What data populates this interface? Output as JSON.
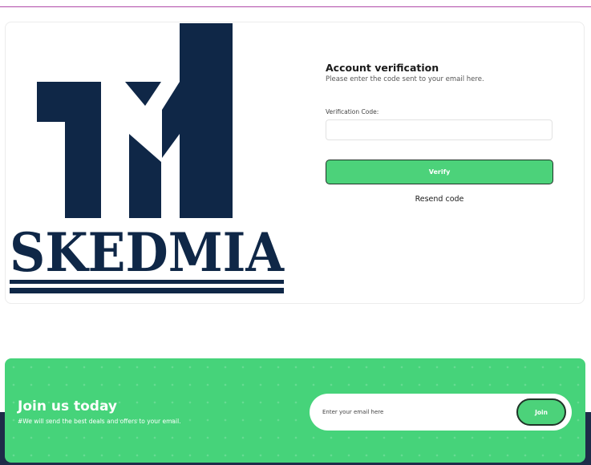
{
  "brand": {
    "name": "SKEDMIA",
    "logo_color": "#0f2747"
  },
  "verification": {
    "title": "Account verification",
    "subtitle": "Please enter the code sent to your email here.",
    "code_label": "Verification Code:",
    "code_value": "",
    "verify_label": "Verify",
    "resend_label": "Resend code"
  },
  "newsletter": {
    "title": "Join us today",
    "subtitle": "#We will send the best deals and offers to your email.",
    "email_placeholder": "Enter your email here",
    "join_label": "Join"
  },
  "colors": {
    "accent_green": "#46d37a",
    "navy": "#1e2c49"
  }
}
